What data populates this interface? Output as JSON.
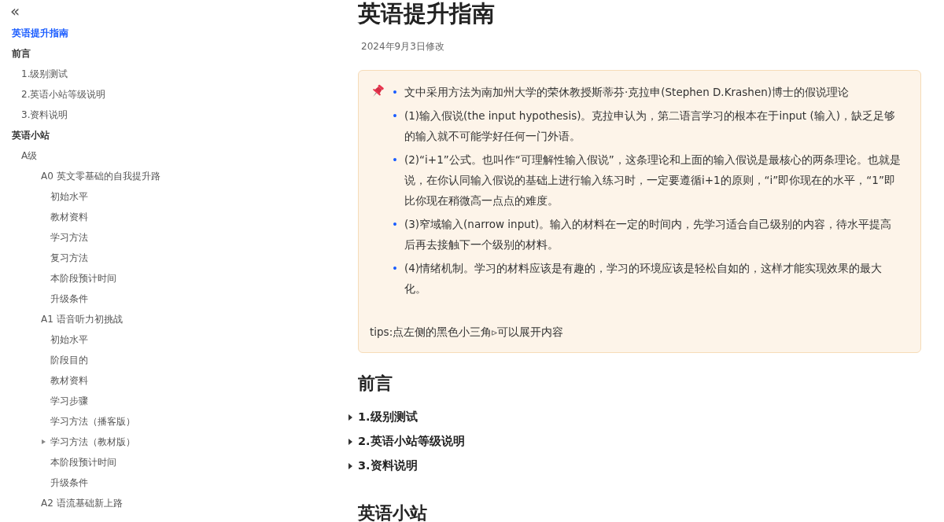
{
  "sidebar": {
    "collapse_label": "«",
    "items": [
      {
        "label": "英语提升指南",
        "selected": true
      },
      {
        "label": "前言",
        "selected": false,
        "children": [
          {
            "label": "1.级别测试",
            "selected": false
          },
          {
            "label": "2.英语小站等级说明",
            "selected": false
          },
          {
            "label": "3.资料说明",
            "selected": false
          }
        ]
      },
      {
        "label": "英语小站",
        "selected": false,
        "children": [
          {
            "label": "A级",
            "selected": false,
            "children": [
              {
                "label": "A0 英文零基础的自我提升路",
                "selected": false,
                "children": [
                  {
                    "label": "初始水平",
                    "selected": false
                  },
                  {
                    "label": "教材资料",
                    "selected": false
                  },
                  {
                    "label": "学习方法",
                    "selected": false
                  },
                  {
                    "label": "复习方法",
                    "selected": false
                  },
                  {
                    "label": "本阶段预计时间",
                    "selected": false
                  },
                  {
                    "label": "升级条件",
                    "selected": false
                  }
                ]
              },
              {
                "label": "A1 语音听力初挑战",
                "selected": false,
                "children": [
                  {
                    "label": "初始水平",
                    "selected": false,
                    "kind": "leaf"
                  },
                  {
                    "label": "阶段目的",
                    "selected": false,
                    "kind": "leaf"
                  },
                  {
                    "label": "教材资料",
                    "selected": false,
                    "kind": "leaf"
                  },
                  {
                    "label": "学习步骤",
                    "selected": false,
                    "kind": "leaf"
                  },
                  {
                    "label": "学习方法（播客版）",
                    "selected": false,
                    "kind": "leaf"
                  },
                  {
                    "label": "学习方法（教材版）",
                    "selected": false,
                    "kind": "collapsible"
                  },
                  {
                    "label": "本阶段预计时间",
                    "selected": false,
                    "kind": "leaf"
                  },
                  {
                    "label": "升级条件",
                    "selected": false,
                    "kind": "leaf"
                  }
                ]
              },
              {
                "label": "A2 语流基础新上路",
                "selected": false
              }
            ]
          }
        ]
      }
    ]
  },
  "page": {
    "title": "英语提升指南",
    "modified": "2024年9月3日修改",
    "callout": {
      "marker": "•",
      "bullets": [
        "文中采用方法为南加州大学的荣休教授斯蒂芬·克拉申(Stephen D.Krashen)博士的假说理论",
        "(1)输入假说(the input hypothesis)。克拉申认为，第二语言学习的根本在于input (输入)，缺乏足够的输入就不可能学好任何一门外语。",
        "(2)“i+1”公式。也叫作“可理解性输入假说”，这条理论和上面的输入假说是最核心的两条理论。也就是说，在你认同输入假说的基础上进行输入练习时，一定要遵循i+1的原则，“i”即你现在的水平，“1”即比你现在稍微高一点点的难度。",
        "(3)窄域输入(narrow input)。输入的材料在一定的时间内，先学习适合自己级别的内容，待水平提高后再去接触下一个级别的材料。",
        "(4)情绪机制。学习的材料应该是有趣的，学习的环境应该是轻松自如的，这样才能实现效果的最大化。"
      ],
      "tip": "tips:点左侧的黑色小三角▹可以展开内容"
    },
    "sections": [
      {
        "kind": "heading",
        "text": "前言"
      },
      {
        "kind": "toggle",
        "text": "1.级别测试"
      },
      {
        "kind": "toggle",
        "text": "2.英语小站等级说明"
      },
      {
        "kind": "toggle",
        "text": "3.资料说明"
      },
      {
        "kind": "heading",
        "text": "英语小站"
      }
    ]
  }
}
